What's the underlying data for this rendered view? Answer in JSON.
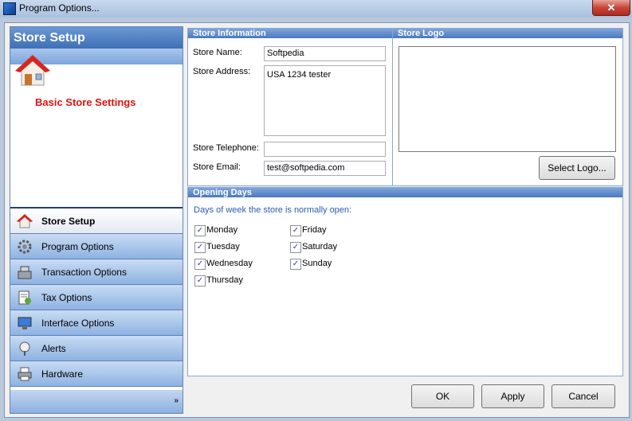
{
  "window": {
    "title": "Program Options...",
    "close_glyph": "✕"
  },
  "sidebar": {
    "header": "Store Setup",
    "section_title": "Basic Store Settings",
    "items": [
      {
        "label": "Store Setup",
        "icon": "house-icon",
        "active": true
      },
      {
        "label": "Program Options",
        "icon": "gear-icon"
      },
      {
        "label": "Transaction Options",
        "icon": "cash-register-icon"
      },
      {
        "label": "Tax Options",
        "icon": "tax-document-icon"
      },
      {
        "label": "Interface Options",
        "icon": "monitor-icon"
      },
      {
        "label": "Alerts",
        "icon": "alert-icon"
      },
      {
        "label": "Hardware",
        "icon": "printer-icon"
      }
    ],
    "footer_glyph": "»"
  },
  "store_info": {
    "title": "Store Information",
    "name_label": "Store Name:",
    "name_value": "Softpedia",
    "address_label": "Store Address:",
    "address_value": "USA 1234 tester",
    "telephone_label": "Store Telephone:",
    "telephone_value": "",
    "email_label": "Store Email:",
    "email_value": "test@softpedia.com"
  },
  "store_logo": {
    "title": "Store Logo",
    "select_button": "Select Logo..."
  },
  "opening_days": {
    "title": "Opening Days",
    "caption": "Days of week the store is normally open:",
    "days": [
      {
        "label": "Monday",
        "checked": true
      },
      {
        "label": "Tuesday",
        "checked": true
      },
      {
        "label": "Wednesday",
        "checked": true
      },
      {
        "label": "Thursday",
        "checked": true
      },
      {
        "label": "Friday",
        "checked": true
      },
      {
        "label": "Saturday",
        "checked": true
      },
      {
        "label": "Sunday",
        "checked": true
      }
    ],
    "check_glyph": "✓"
  },
  "buttons": {
    "ok": "OK",
    "apply": "Apply",
    "cancel": "Cancel"
  },
  "colors": {
    "accent": "#3f6fb5",
    "section_title": "#e0120c",
    "caption": "#2a5db0"
  }
}
